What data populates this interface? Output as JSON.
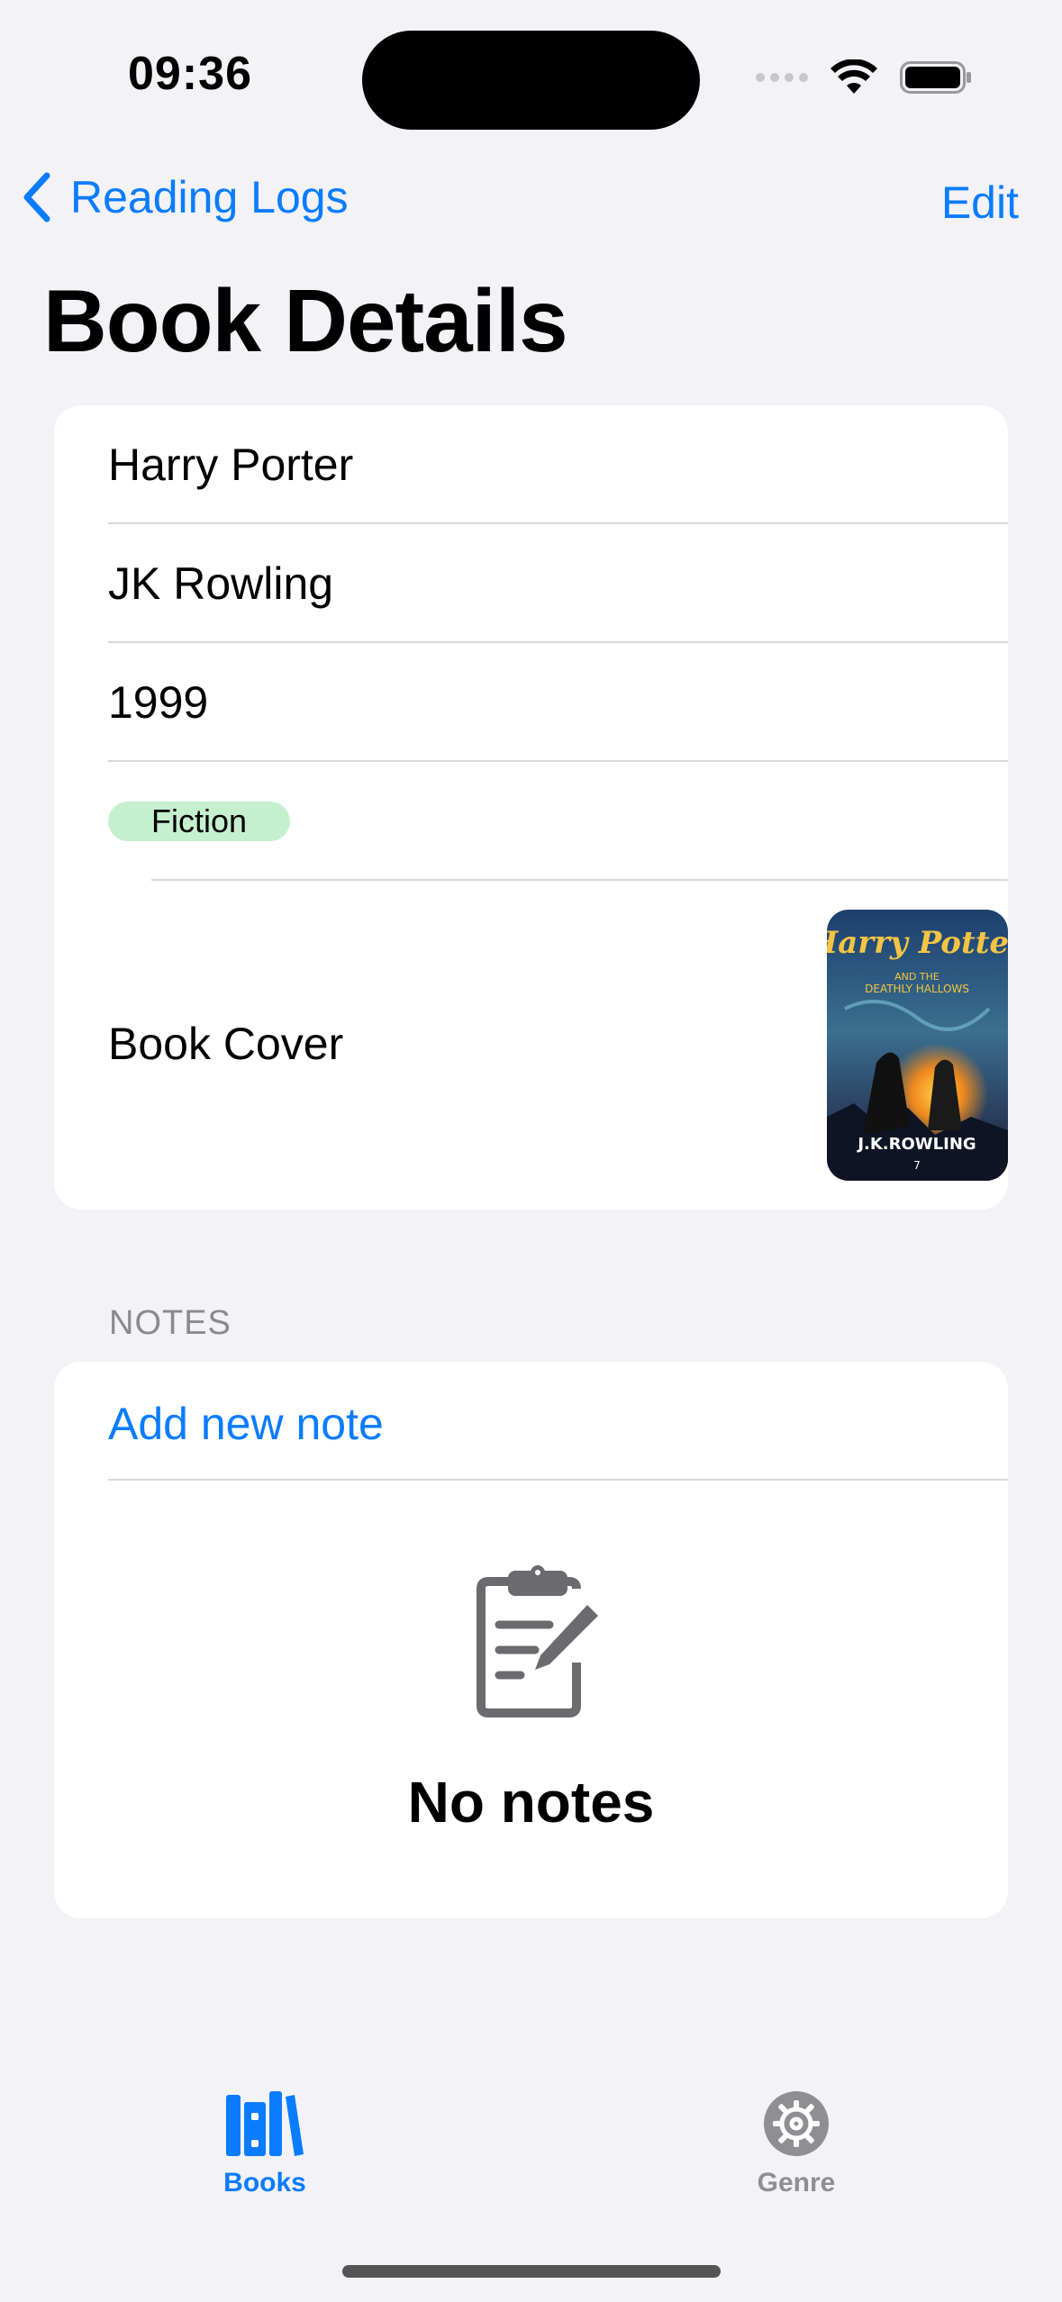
{
  "status_bar": {
    "time": "09:36"
  },
  "nav": {
    "back_label": "Reading Logs",
    "edit_label": "Edit",
    "title": "Book Details"
  },
  "book": {
    "title": "Harry Porter",
    "author": "JK Rowling",
    "year": "1999",
    "genre": "Fiction",
    "cover_label": "Book Cover",
    "cover_art": {
      "title_line1": "Harry Potter",
      "subtitle_line1": "AND THE",
      "subtitle_line2": "DEATHLY HALLOWS",
      "author": "J.K.ROWLING",
      "number": "7"
    }
  },
  "notes": {
    "section_header": "NOTES",
    "add_label": "Add new note",
    "empty_text": "No notes",
    "empty_icon": "clipboard-pencil-icon"
  },
  "tab_bar": {
    "tabs": [
      {
        "label": "Books",
        "icon": "books-icon",
        "selected": true
      },
      {
        "label": "Genre",
        "icon": "gear-icon",
        "selected": false
      }
    ]
  },
  "colors": {
    "accent": "#0a7cff",
    "background": "#f2f2f7",
    "genre_badge": "#c6f0cd",
    "inactive_tab": "#8e8e93"
  }
}
